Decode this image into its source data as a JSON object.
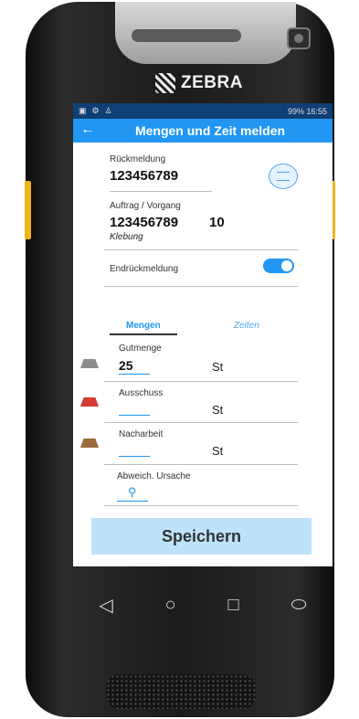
{
  "device": {
    "brand": "ZEBRA"
  },
  "status_bar": {
    "left_icons": [
      "image-icon",
      "settings-icon",
      "person-icon"
    ],
    "right_text": "99%  16:55"
  },
  "app_bar": {
    "title": "Mengen und Zeit melden"
  },
  "rueckmeldung": {
    "label": "Rückmeldung",
    "value": "123456789"
  },
  "auftrag": {
    "label": "Auftrag / Vorgang",
    "value": "123456789",
    "vorgang": "10",
    "description": "Klebung"
  },
  "endrueckmeldung": {
    "label": "Endrückmeldung",
    "enabled": true
  },
  "tabs": [
    {
      "label": "Mengen",
      "active": true
    },
    {
      "label": "Zeiten",
      "active": false
    }
  ],
  "quantities": [
    {
      "label": "Gutmenge",
      "value": "25",
      "unit": "St",
      "icon": "ingot-gray-icon",
      "color": "#8c8c8c"
    },
    {
      "label": "Ausschuss",
      "value": "",
      "unit": "St",
      "icon": "ingot-red-icon",
      "color": "#d43a2f"
    },
    {
      "label": "Nacharbeit",
      "value": "",
      "unit": "St",
      "icon": "ingot-bronze-icon",
      "color": "#9b6a3c"
    }
  ],
  "abweichung": {
    "label": "Abweich. Ursache"
  },
  "save": {
    "label": "Speichern"
  },
  "nav": {
    "back": "◁",
    "home": "○",
    "recent": "□",
    "extra": "⬭"
  },
  "colors": {
    "accent": "#2196f3",
    "status_bar": "#0f3f74",
    "save_button_bg": "#bfe2fb"
  }
}
